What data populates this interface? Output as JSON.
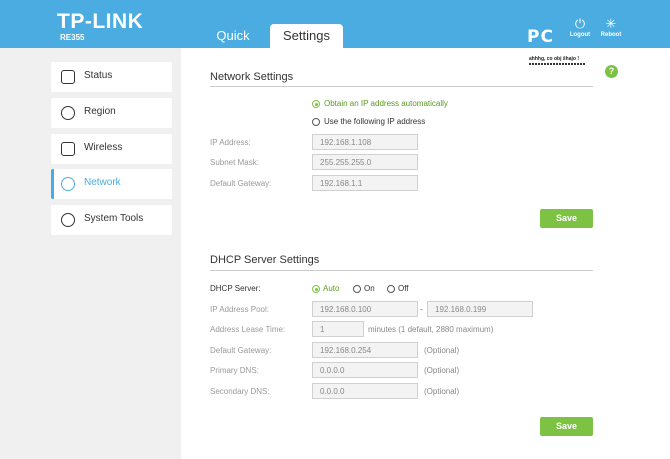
{
  "header": {
    "brand": "TP-LINK",
    "model": "RE355",
    "tabs": [
      {
        "label": "Quick Setup",
        "active": false
      },
      {
        "label": "Settings",
        "active": true
      }
    ],
    "logout_label": "Logout",
    "reboot_label": "Reboot",
    "watermark_text": "PC",
    "watermark_sub": "ahhhg, co obj šhajo !",
    "accent_color": "#4aace0"
  },
  "sidebar": {
    "items": [
      {
        "label": "Status",
        "icon": "status-icon",
        "active": false
      },
      {
        "label": "Region",
        "icon": "globe-icon",
        "active": false
      },
      {
        "label": "Wireless",
        "icon": "wireless-icon",
        "active": false
      },
      {
        "label": "Network",
        "icon": "network-globe-icon",
        "active": true
      },
      {
        "label": "System Tools",
        "icon": "gear-icon",
        "active": false
      }
    ]
  },
  "help": "?",
  "network": {
    "title": "Network Settings",
    "option_auto": "Obtain an IP address automatically",
    "option_manual": "Use the following IP address",
    "selected": "auto",
    "ip_label": "IP Address:",
    "ip_value": "192.168.1.108",
    "mask_label": "Subnet Mask:",
    "mask_value": "255.255.255.0",
    "gateway_label": "Default Gateway:",
    "gateway_value": "192.168.1.1",
    "save_label": "Save"
  },
  "dhcp": {
    "title": "DHCP Server Settings",
    "server_label": "DHCP Server:",
    "opt_auto": "Auto",
    "opt_on": "On",
    "opt_off": "Off",
    "selected": "auto",
    "pool_label": "IP Address Pool:",
    "pool_start": "192.168.0.100",
    "pool_sep": "-",
    "pool_end": "192.168.0.199",
    "lease_label": "Address Lease Time:",
    "lease_value": "1",
    "lease_note": "minutes (1 default, 2880 maximum)",
    "gateway_label": "Default Gateway:",
    "gateway_value": "192.168.0.254",
    "primary_dns_label": "Primary DNS:",
    "primary_dns_value": "0.0.0.0",
    "secondary_dns_label": "Secondary DNS:",
    "secondary_dns_value": "0.0.0.0",
    "optional": "(Optional)",
    "save_label": "Save"
  },
  "colors": {
    "header": "#4aace0",
    "save_button": "#7dc242",
    "sidebar_bg": "#f0f0f0"
  }
}
